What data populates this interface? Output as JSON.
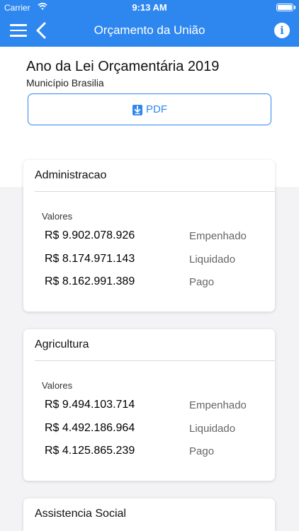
{
  "status_bar": {
    "carrier": "Carrier",
    "time": "9:13 AM"
  },
  "nav": {
    "title": "Orçamento da União",
    "info_label": "i"
  },
  "header": {
    "title": "Ano da Lei Orçamentária 2019",
    "municipio": "Município Brasilia",
    "pdf_label": "PDF"
  },
  "cards": [
    {
      "title": "Administracao",
      "valores_label": "Valores",
      "rows": [
        {
          "amount": "R$ 9.902.078.926",
          "kind": "Empenhado"
        },
        {
          "amount": "R$ 8.174.971.143",
          "kind": "Liquidado"
        },
        {
          "amount": "R$ 8.162.991.389",
          "kind": "Pago"
        }
      ]
    },
    {
      "title": "Agricultura",
      "valores_label": "Valores",
      "rows": [
        {
          "amount": "R$ 9.494.103.714",
          "kind": "Empenhado"
        },
        {
          "amount": "R$ 4.492.186.964",
          "kind": "Liquidado"
        },
        {
          "amount": "R$ 4.125.865.239",
          "kind": "Pago"
        }
      ]
    },
    {
      "title": "Assistencia Social"
    }
  ],
  "colors": {
    "accent": "#2e87ef",
    "background": "#f3f3f5"
  }
}
